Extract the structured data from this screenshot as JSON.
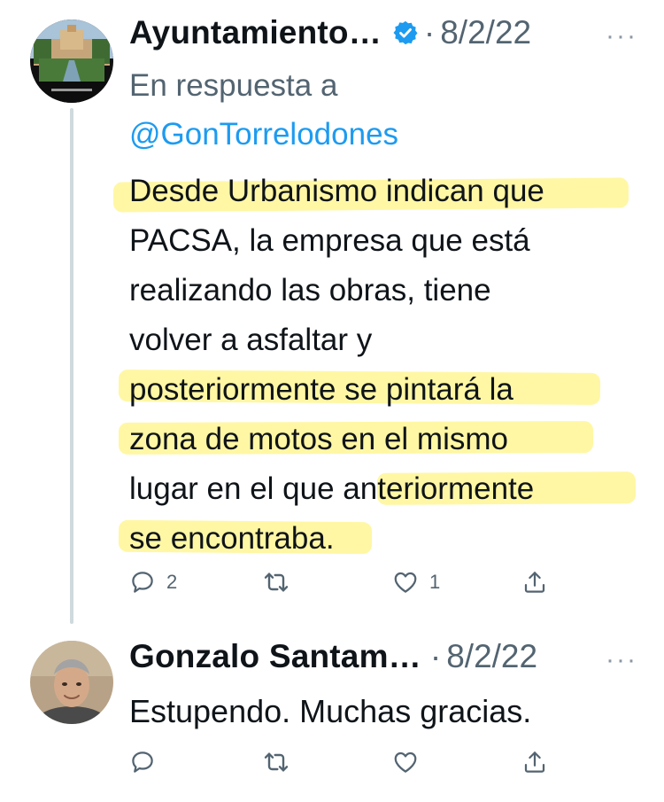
{
  "tweet1": {
    "author": "Ayuntamiento…",
    "separator": "·",
    "date": "8/2/22",
    "more": "···",
    "reply_prefix": "En respuesta a",
    "reply_handle": "@GonTorrelodones",
    "lines": [
      "Desde Urbanismo indican que",
      "PACSA, la empresa que está",
      "realizando las obras, tiene",
      "volver a asfaltar y",
      "posteriormente se pintará la",
      "zona de motos en el mismo",
      "lugar en el que anteriormente",
      "se encontraba."
    ],
    "reply_count": "2",
    "like_count": "1",
    "icons": [
      "reply-icon",
      "retweet-icon",
      "like-icon",
      "share-icon",
      "verified-badge-icon"
    ]
  },
  "tweet2": {
    "author": "Gonzalo Santam…",
    "separator": "·",
    "date": "8/2/22",
    "more": "···",
    "text": "Estupendo. Muchas gracias.",
    "icons": [
      "reply-icon",
      "retweet-icon",
      "like-icon",
      "share-icon"
    ]
  },
  "colors": {
    "text": "#0f1419",
    "secondary": "#536471",
    "link": "#1d9bf0",
    "verified": "#1d9bf0",
    "highlight": "#fff05a",
    "thread_line": "#cfd9de"
  }
}
